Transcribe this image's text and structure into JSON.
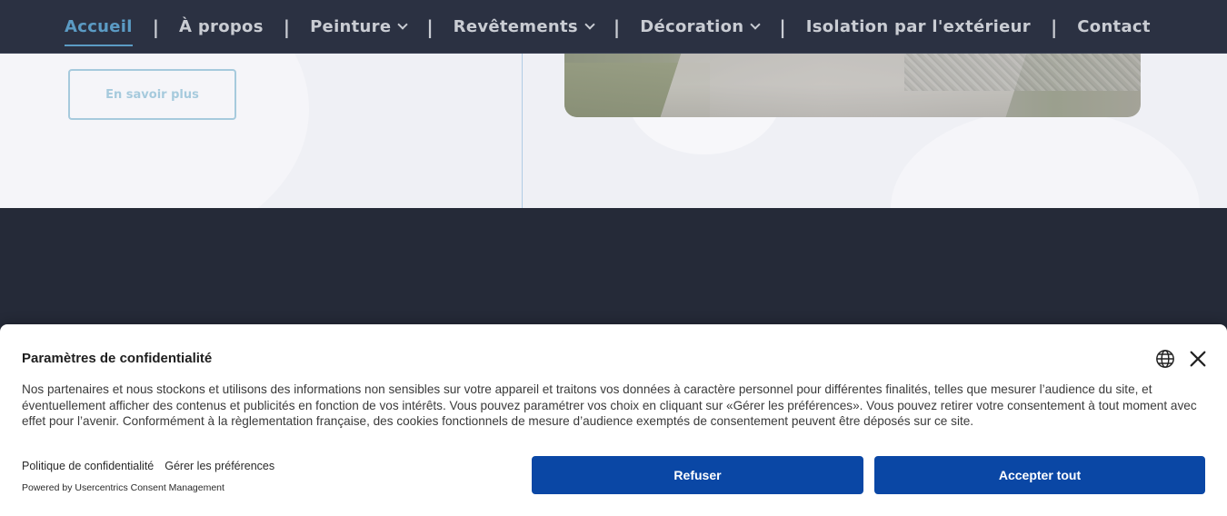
{
  "nav": {
    "items": [
      {
        "label": "Accueil",
        "active": true,
        "dropdown": false
      },
      {
        "label": "À propos",
        "active": false,
        "dropdown": false
      },
      {
        "label": "Peinture",
        "active": false,
        "dropdown": true
      },
      {
        "label": "Revêtements",
        "active": false,
        "dropdown": true
      },
      {
        "label": "Décoration",
        "active": false,
        "dropdown": true
      },
      {
        "label": "Isolation par l'extérieur",
        "active": false,
        "dropdown": false
      },
      {
        "label": "Contact",
        "active": false,
        "dropdown": false
      }
    ],
    "separator": "|"
  },
  "hero": {
    "cta_label": "En savoir plus"
  },
  "consent": {
    "title": "Paramètres de confidentialité",
    "body": "Nos partenaires et nous stockons et utilisons des informations non sensibles sur votre appareil et traitons vos données à caractère personnel pour différentes finalités, telles que mesurer l’audience du site, et éventuellement afficher des contenus et publicités en fonction de vos intérêts. Vous pouvez paramétrer vos choix en cliquant sur «Gérer les préférences». Vous pouvez retirer votre consentement à tout moment avec effet pour l’avenir. Conformément à la règlementation française, des cookies fonctionnels de mesure d’audience exemptés de consentement peuvent être déposés sur ce site.",
    "privacy_link": "Politique de confidentialité",
    "manage_link": "Gérer les préférences",
    "powered_by": "Powered by Usercentrics Consent Management",
    "refuse_label": "Refuser",
    "accept_label": "Accepter tout"
  },
  "icons": {
    "language": "globe-icon",
    "close": "close-icon",
    "dropdown": "chevron-down-icon"
  },
  "colors": {
    "nav_bg": "#2b3142",
    "nav_text": "#c9ccd3",
    "nav_active": "#5b9bc4",
    "page_dark": "#252a38",
    "button_primary": "#0a47a5",
    "cta_outline": "#7fb6d0"
  }
}
